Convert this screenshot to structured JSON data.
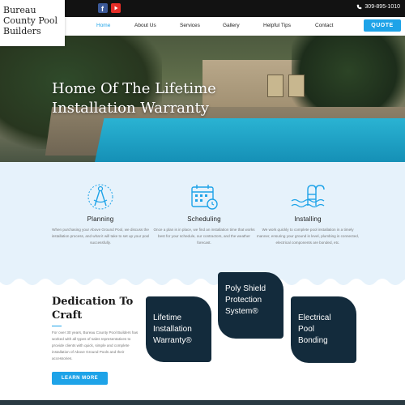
{
  "logo": {
    "lines": [
      "Bureau",
      "County Pool",
      "Builders"
    ]
  },
  "topbar": {
    "phone": "309-895-1010",
    "social": [
      "facebook-icon",
      "youtube-icon"
    ]
  },
  "nav": {
    "items": [
      "Home",
      "About Us",
      "Services",
      "Gallery",
      "Helpful Tips",
      "Contact"
    ],
    "active": "Home",
    "quote_label": "QUOTE"
  },
  "hero": {
    "title": "Home Of The Lifetime Installation Warranty"
  },
  "features": [
    {
      "icon": "compass-icon",
      "title": "Planning",
      "text": "When purchasing your Above Ground Pool, we discuss the installation process, and what it will take to set up your pool successfully."
    },
    {
      "icon": "calendar-icon",
      "title": "Scheduling",
      "text": "Once a plan is in place, we find an installation time that works best for your schedule, our contractors, and the weather forecast."
    },
    {
      "icon": "pool-ladder-icon",
      "title": "Installing",
      "text": "We work quickly to complete pool installation in a timely manner, ensuring your ground is level, plumbing is connected, electrical components are bonded, etc."
    }
  ],
  "dedication": {
    "title": "Dedication To Craft",
    "text": "For over 30 years, Bureau County Pool Builders has worked with all types of sales representatives to provide clients with quick, simple and complete installation of Above Ground Pools and their accessories.",
    "button_label": "LEARN MORE"
  },
  "cards": [
    {
      "lines": [
        "Lifetime",
        "Installation",
        "Warranty®"
      ]
    },
    {
      "lines": [
        "Poly Shield",
        "Protection",
        "System®"
      ]
    },
    {
      "lines": [
        "Electrical",
        "Pool",
        "Bonding"
      ]
    }
  ],
  "colors": {
    "accent": "#1ea3e8",
    "card_bg": "#132b3c",
    "band_bg": "#e6f2fb",
    "topbar_bg": "#121212"
  }
}
